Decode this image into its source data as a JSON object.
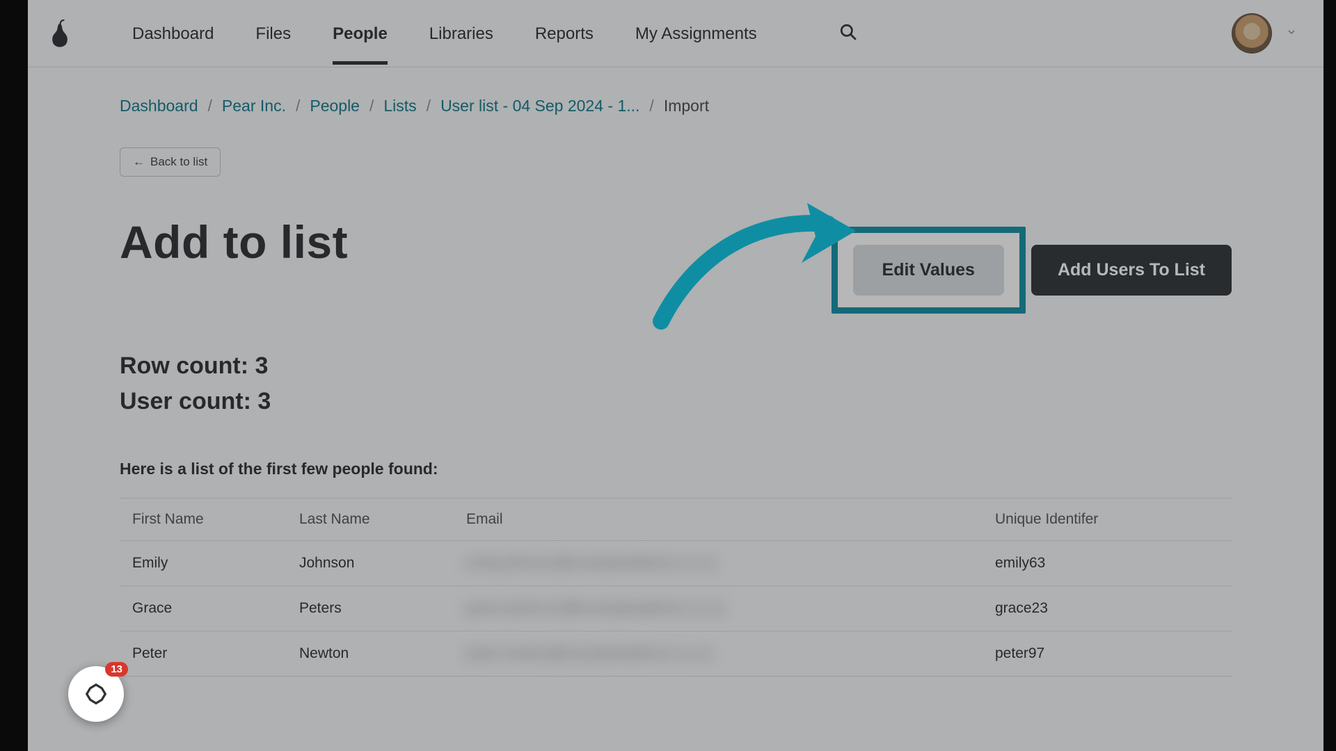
{
  "nav": {
    "items": [
      "Dashboard",
      "Files",
      "People",
      "Libraries",
      "Reports",
      "My Assignments"
    ],
    "active_index": 2
  },
  "breadcrumb": {
    "items": [
      "Dashboard",
      "Pear Inc.",
      "People",
      "Lists",
      "User list - 04 Sep 2024 - 1..."
    ],
    "current": "Import"
  },
  "back_button": "Back to list",
  "page_title": "Add to list",
  "buttons": {
    "edit_values": "Edit Values",
    "add_users": "Add Users To List"
  },
  "counts": {
    "row_label": "Row count:",
    "row_value": "3",
    "user_label": "User count:",
    "user_value": "3"
  },
  "table_lead": "Here is a list of the first few people found:",
  "table": {
    "headers": [
      "First Name",
      "Last Name",
      "Email",
      "Unique Identifer"
    ],
    "rows": [
      {
        "first": "Emily",
        "last": "Johnson",
        "email": "emily.johnson@exampleaddress.co.za",
        "uid": "emily63"
      },
      {
        "first": "Grace",
        "last": "Peters",
        "email": "grace.peters12@exampleaddress.co.za",
        "uid": "grace23"
      },
      {
        "first": "Peter",
        "last": "Newton",
        "email": "peter.newton@exampleaddress.co.za",
        "uid": "peter97"
      }
    ]
  },
  "widget": {
    "badge": "13"
  },
  "colors": {
    "highlight": "#0f8ea3",
    "link": "#117789",
    "dark": "#2b2f33"
  }
}
